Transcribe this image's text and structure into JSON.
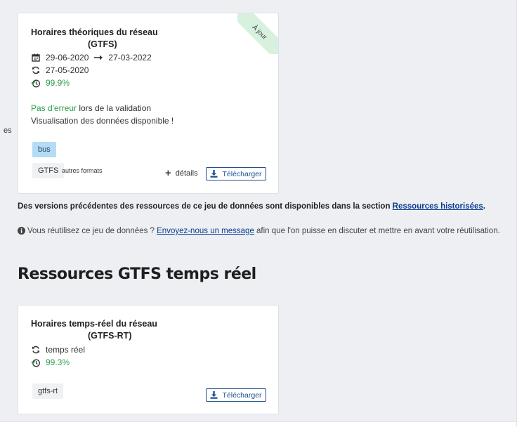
{
  "side": {
    "text": "es"
  },
  "card1": {
    "title_line1": "Horaires théoriques du réseau",
    "title_line2": "(GTFS)",
    "ribbon": "À jour",
    "date_start": "29-06-2020",
    "date_end": "27-03-2022",
    "updated": "27-05-2020",
    "availability": "99.9%",
    "validation_ok": "Pas d'erreur",
    "validation_rest": " lors de la validation",
    "visualisation": "Visualisation des données disponible !",
    "tag_mode": "bus",
    "tag_format": "GTFS",
    "other_formats": "autres formats",
    "details_label": "détails",
    "download_label": "Télécharger"
  },
  "history": {
    "text": "Des versions précédentes des ressources de ce jeu de données sont disponibles dans la section ",
    "link": "Ressources historisées",
    "end": "."
  },
  "reuse": {
    "text": "Vous réutilisez ce jeu de données ? ",
    "link": "Envoyez-nous un message",
    "end": " afin que l'on puisse en discuter et mettre en avant votre réutilisation."
  },
  "section": {
    "title": "Ressources GTFS temps réel"
  },
  "card2": {
    "title_line1": "Horaires temps-réel du réseau",
    "title_line2": "(GTFS-RT)",
    "update_freq": "temps réel",
    "availability": "99.3%",
    "tag_format": "gtfs-rt",
    "download_label": "Télécharger"
  },
  "colors": {
    "accent": "#1f4f8f",
    "ok": "#2d9c4a",
    "ribbon": "#d7f1de",
    "tag_bus": "#b3dcf7"
  }
}
